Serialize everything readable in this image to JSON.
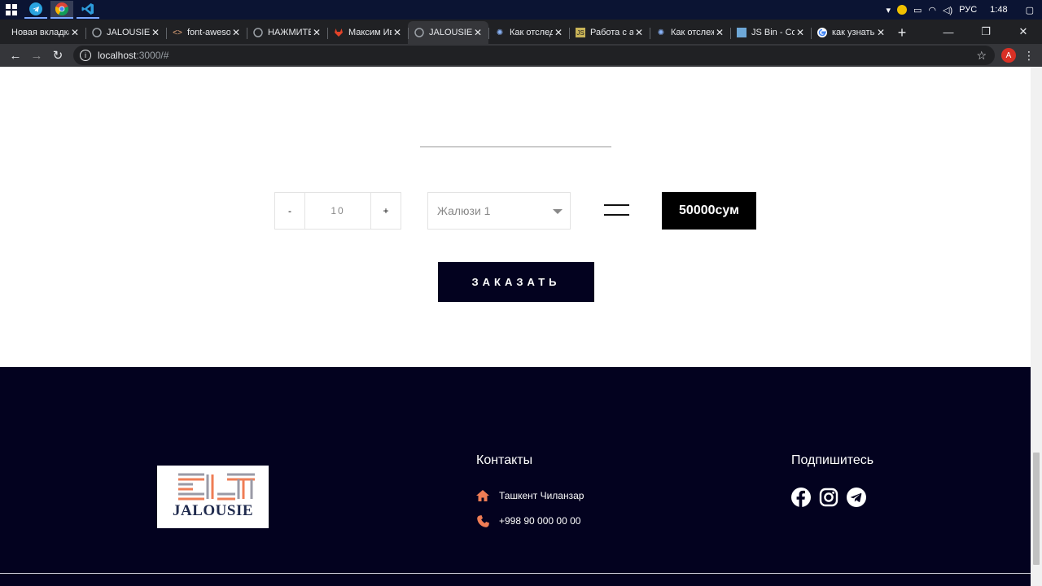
{
  "browser": {
    "tabs": [
      {
        "title": "Новая вкладка",
        "favicon": "none"
      },
      {
        "title": "JALOUSIE",
        "favicon": "globe-icon"
      },
      {
        "title": "font-awesome",
        "favicon": "code-icon"
      },
      {
        "title": "НАЖМИТЕ",
        "favicon": "globe-icon"
      },
      {
        "title": "Максим Ив",
        "favicon": "gitlab-icon"
      },
      {
        "title": "JALOUSIE",
        "favicon": "globe-icon",
        "active": true
      },
      {
        "title": "Как отслед",
        "favicon": "spark-icon"
      },
      {
        "title": "Работа с ат",
        "favicon": "js-icon"
      },
      {
        "title": "Как отслеж",
        "favicon": "spark-icon"
      },
      {
        "title": "JS Bin - Col",
        "favicon": "jsbin-icon"
      },
      {
        "title": "как узнать",
        "favicon": "google-icon"
      }
    ],
    "url_host": "localhost",
    "url_path": ":3000/#",
    "profile_initial": "A"
  },
  "system": {
    "lang": "РУС",
    "time": "1:48"
  },
  "order": {
    "qty_minus": "-",
    "qty_value": "10",
    "qty_plus": "+",
    "product_selected": "Жалюзи 1",
    "price": "50000сум",
    "order_button": "ЗАКАЗАТЬ"
  },
  "footer": {
    "logo_text": "JALOUSIE",
    "contacts_title": "Контакты",
    "address": "Ташкент Чиланзар",
    "phone": "+998 90 000 00 00",
    "subscribe_title": "Подпишитесь",
    "accent_color": "#ef7d55",
    "background_color": "#03021f"
  }
}
